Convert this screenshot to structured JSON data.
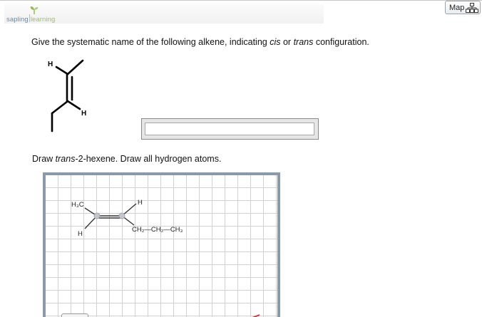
{
  "brand": {
    "part1": "sapling",
    "part2": "learning",
    "leaf_color": "#8dbb4e"
  },
  "map_button": {
    "label": "Map"
  },
  "question": {
    "pre": "Give the systematic name of the following alkene, indicating ",
    "cis": "cis",
    "mid": " or ",
    "trans": "trans",
    "post": " configuration."
  },
  "structure1": {
    "atom_top": "H",
    "atom_bottom": "H"
  },
  "answer": {
    "value": ""
  },
  "draw_prompt": {
    "pre": "Draw ",
    "italic": "trans",
    "post": "-2-hexene. Draw all hydrogen atoms."
  },
  "canvas": {
    "atom_h3c": "H₃C",
    "atom_h_top": "H",
    "atom_h_bottom": "H",
    "chain": "CH₂—CH₂—CH₃",
    "grid_color": "#b9d7ef",
    "frame_color": "#8a9aab"
  }
}
